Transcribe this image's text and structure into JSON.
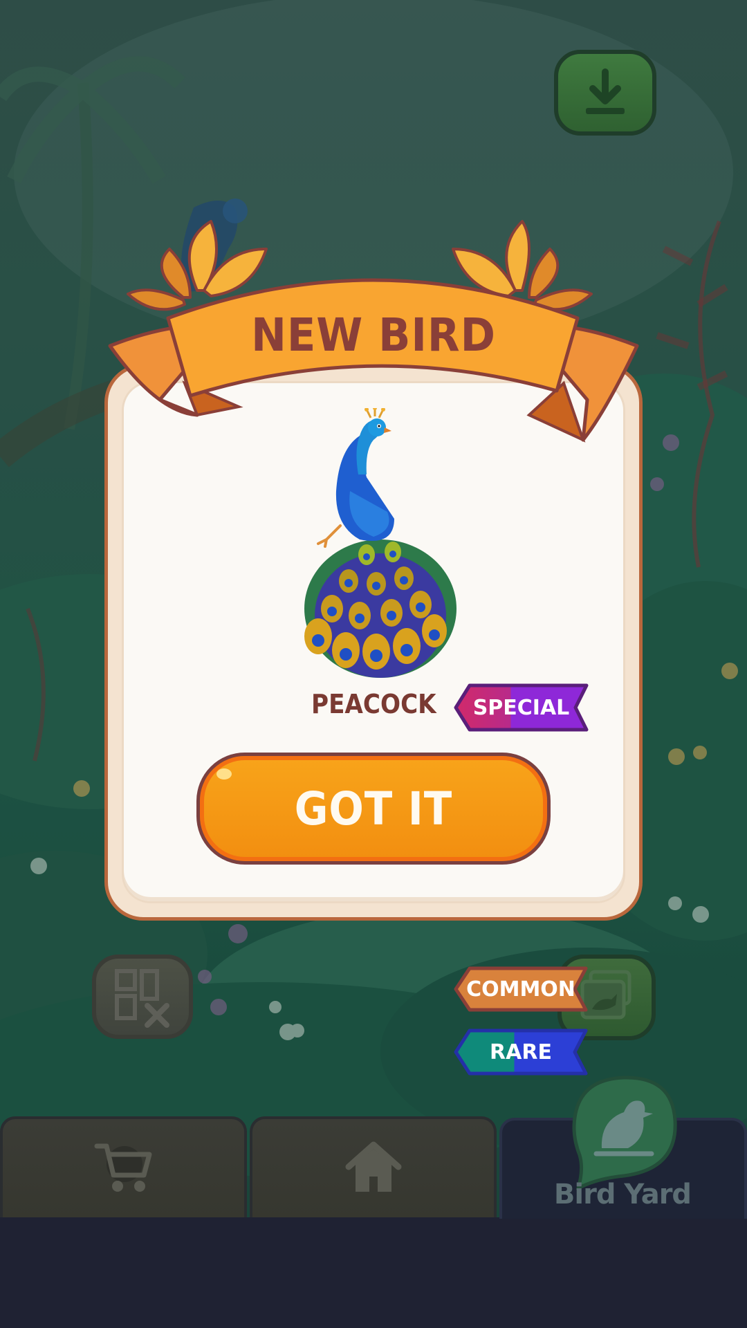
{
  "modal": {
    "title": "NEW BIRD",
    "bird": {
      "name": "PEACOCK",
      "rarity": "SPECIAL",
      "icon": "peacock-illustration"
    },
    "confirm_label": "GOT IT"
  },
  "rarity_tags": {
    "common": "COMMON",
    "rare": "RARE"
  },
  "top_controls": {
    "download_icon": "download-icon"
  },
  "side_buttons": {
    "remove_ads_icon": "no-ads-icon",
    "gallery_icon": "bird-gallery-icon"
  },
  "bottom_nav": {
    "tabs": [
      {
        "id": "shop",
        "icon": "cart-icon",
        "label": ""
      },
      {
        "id": "home",
        "icon": "home-icon",
        "label": ""
      },
      {
        "id": "bird-yard",
        "icon": "bird-icon",
        "label": "Bird Yard",
        "active": true
      }
    ]
  },
  "colors": {
    "banner": "#f9a531",
    "title_text": "#8a3f38",
    "button": "#f59a14",
    "special_tag": "#8e28d8",
    "common_tag": "#d9823c",
    "rare_tag": "#2c3fd6",
    "bottom_bar": "#1f2233"
  }
}
